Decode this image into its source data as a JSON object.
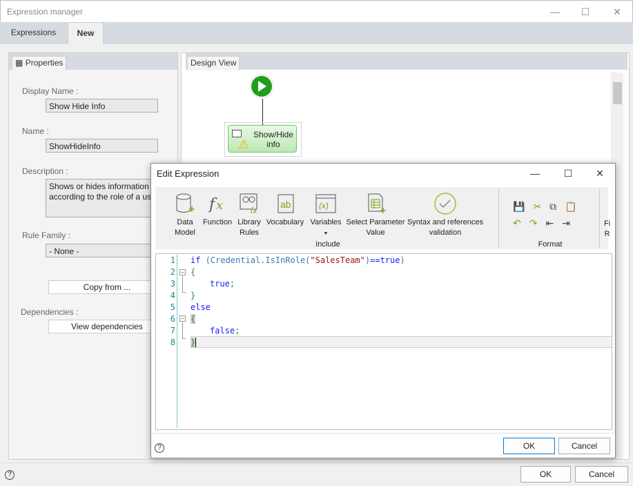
{
  "window": {
    "title": "Expression manager",
    "tabs": [
      {
        "label": "Expressions"
      },
      {
        "label": "New"
      }
    ],
    "ok_label": "OK",
    "cancel_label": "Cancel"
  },
  "properties": {
    "tab_label": "Properties",
    "display_name_label": "Display Name :",
    "display_name_value": "Show Hide Info",
    "name_label": "Name :",
    "name_value": "ShowHideInfo",
    "description_label": "Description :",
    "description_value": "Shows or hides information according to the role of a user",
    "rule_family_label": "Rule Family :",
    "rule_family_value": "- None -",
    "copy_from_label": "Copy from ...",
    "dependencies_label": "Dependencies :",
    "view_dependencies_label": "View dependencies"
  },
  "design": {
    "tab_label": "Design View",
    "node_label": "Show/Hide info"
  },
  "dialog": {
    "title": "Edit Expression",
    "include_items": [
      {
        "label": "Data Model",
        "icon": "database-icon"
      },
      {
        "label": "Function",
        "icon": "fx-icon"
      },
      {
        "label": "Library Rules",
        "icon": "library-rules-icon"
      },
      {
        "label": "Vocabulary",
        "icon": "vocabulary-icon"
      },
      {
        "label": "Variables",
        "icon": "variables-icon"
      },
      {
        "label": "Select Parameter Value",
        "icon": "parameter-icon"
      },
      {
        "label": "Syntax and references validation",
        "icon": "validation-icon"
      }
    ],
    "include_group": "Include",
    "format_group": "Format",
    "partial_label_1": "Fi",
    "partial_label_2": "R",
    "code_lines": [
      {
        "n": "1"
      },
      {
        "n": "2"
      },
      {
        "n": "3"
      },
      {
        "n": "4"
      },
      {
        "n": "5"
      },
      {
        "n": "6"
      },
      {
        "n": "7"
      },
      {
        "n": "8"
      }
    ],
    "code": {
      "if": "if",
      "paren_open": " (",
      "cls": "Credential.IsInRole(",
      "str": "\"SalesTeam\"",
      "close": ")",
      "eq": "==true",
      "paren_close": ")",
      "lbrace": "{",
      "rbrace": "}",
      "true_kw": "true",
      "false_kw": "false",
      "semi": ";",
      "else": "else"
    },
    "ok_label": "OK",
    "cancel_label": "Cancel"
  },
  "colors": {
    "keyword": "#1a1aff",
    "class": "#3b7ab5",
    "string": "#a31515",
    "brace": "#2e8b2e",
    "accent_green": "#7aa61a"
  }
}
